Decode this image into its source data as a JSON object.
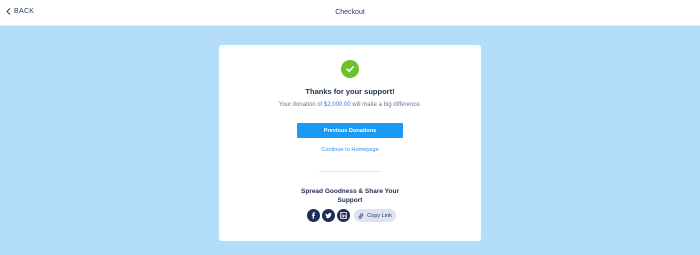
{
  "header": {
    "back_label": "BACK",
    "title": "Checkout"
  },
  "confirmation": {
    "heading": "Thanks for your support!",
    "message_before": "Your donation of ",
    "amount": "$2,000.00",
    "message_after": " will make a big difference.",
    "primary_button": "Previous Donations",
    "secondary_link": "Continue to Homepage"
  },
  "share": {
    "title": "Spread Goodness & Share Your Support",
    "icons": [
      "facebook-icon",
      "twitter-icon",
      "linkedin-icon",
      "link-icon"
    ],
    "copy_label": "Copy Link"
  },
  "colors": {
    "page_background": "#b3ddfb",
    "success": "#6cc12a",
    "primary": "#1a9af5",
    "social_icon_bg": "#1f2d5a"
  }
}
